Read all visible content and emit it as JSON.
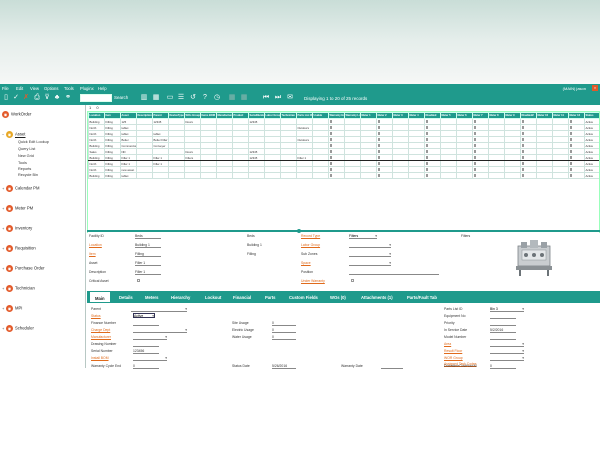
{
  "menu": [
    "File",
    "Edit",
    "View",
    "Options",
    "Tools",
    "Pluginx",
    "Help"
  ],
  "user": "(MAIN)  jason",
  "close_icon": "×",
  "toolbar": {
    "search_label": "Search",
    "records_label": "Displaying 1 to 20 of 25 records"
  },
  "sidebar": {
    "items": [
      {
        "label": "WorkOrder",
        "color": "#e35b2b"
      },
      {
        "label": "Asset",
        "color": "#e8a826"
      },
      {
        "label": "Calendar PM",
        "color": "#e35b2b"
      },
      {
        "label": "Meter PM",
        "color": "#e35b2b"
      },
      {
        "label": "Inventory",
        "color": "#e35b2b"
      },
      {
        "label": "Requisition",
        "color": "#e35b2b"
      },
      {
        "label": "Purchase Order",
        "color": "#e35b2b"
      },
      {
        "label": "Technician",
        "color": "#e35b2b"
      },
      {
        "label": "MPI",
        "color": "#e35b2b"
      },
      {
        "label": "Scheduler",
        "color": "#e35b2b"
      }
    ],
    "asset_children": [
      "Quick Edit Lookup",
      "Query List",
      "New Grid",
      "Tools",
      "Reports",
      "Recycle Bin"
    ]
  },
  "grid_tabs": [
    "1",
    "0"
  ],
  "grid": {
    "headers": [
      "Location",
      "Item",
      "Asset",
      "Description",
      "Parent",
      "DeviceType",
      "WOs Group",
      "Items BOM",
      "Manufacturer",
      "Product",
      "SerialNumber",
      "Labor Group",
      "Technician",
      "Parts List ID",
      "Usable",
      "Warranty End",
      "Warranty Location",
      "Meter 1",
      "Meter 2",
      "Meter 3",
      "Meter 4",
      "Disabled",
      "Meter 5",
      "Meter 6",
      "Meter 7",
      "Meter 8",
      "Meter 9",
      "Disabled2",
      "Meter 10",
      "Meter 11",
      "Meter 12",
      "Status"
    ],
    "rows": [
      [
        "Building",
        "Filling",
        "125",
        "",
        "12345",
        "",
        "Doors",
        "",
        "",
        "",
        "12345",
        "",
        "",
        "",
        "",
        "",
        "",
        "",
        "",
        "",
        "",
        "",
        "",
        "",
        "",
        "",
        "",
        "",
        "",
        "",
        "",
        "Active"
      ],
      [
        "North",
        "Filling",
        "tablet",
        "",
        "",
        "",
        "",
        "",
        "",
        "",
        "",
        "",
        "",
        "Outdoors",
        "",
        "",
        "",
        "",
        "",
        "",
        "",
        "",
        "",
        "",
        "",
        "",
        "",
        "",
        "",
        "",
        "",
        "Active"
      ],
      [
        "North",
        "Filling",
        "tablet",
        "",
        "tablet",
        "",
        "",
        "",
        "",
        "",
        "",
        "",
        "",
        "",
        "",
        "",
        "",
        "",
        "",
        "",
        "",
        "",
        "",
        "",
        "",
        "",
        "",
        "",
        "",
        "",
        "",
        "Active"
      ],
      [
        "North",
        "Filling",
        "Boiler",
        "",
        "Boiler Filler",
        "",
        "",
        "",
        "",
        "",
        "",
        "",
        "",
        "Outdoors",
        "",
        "",
        "",
        "",
        "",
        "",
        "",
        "",
        "",
        "",
        "",
        "",
        "",
        "",
        "",
        "",
        "",
        "Active"
      ],
      [
        "Building",
        "Filling",
        "Commercial Conveyor",
        "",
        "Conveyer",
        "",
        "",
        "",
        "",
        "",
        "",
        "",
        "",
        "",
        "",
        "",
        "",
        "",
        "",
        "",
        "",
        "",
        "",
        "",
        "",
        "",
        "",
        "",
        "",
        "",
        "",
        "Active"
      ],
      [
        "Sales",
        "Filling",
        "ND",
        "",
        "",
        "",
        "Doors",
        "",
        "",
        "",
        "12345",
        "",
        "",
        "",
        "",
        "",
        "",
        "",
        "",
        "",
        "",
        "",
        "",
        "",
        "",
        "",
        "",
        "",
        "",
        "",
        "",
        "Active"
      ],
      [
        "Building",
        "Filling",
        "Filler 1",
        "",
        "Filler 1",
        "",
        "Filters",
        "",
        "",
        "",
        "12345",
        "",
        "",
        "Filter 1",
        "",
        "",
        "",
        "",
        "",
        "",
        "",
        "",
        "",
        "",
        "",
        "",
        "",
        "",
        "",
        "",
        "",
        "Active"
      ],
      [
        "North",
        "Filling",
        "Filler 1",
        "",
        "Filler 1",
        "",
        "",
        "",
        "",
        "",
        "",
        "",
        "",
        "",
        "",
        "",
        "",
        "",
        "",
        "",
        "",
        "",
        "",
        "",
        "",
        "",
        "",
        "",
        "",
        "",
        "",
        "Active"
      ],
      [
        "North",
        "Filling",
        "new asset",
        "",
        "",
        "",
        "",
        "",
        "",
        "",
        "",
        "",
        "",
        "",
        "",
        "",
        "",
        "",
        "",
        "",
        "",
        "",
        "",
        "",
        "",
        "",
        "",
        "",
        "",
        "",
        "",
        "Active"
      ],
      [
        "Building",
        "Filling",
        "tablet",
        "",
        "",
        "",
        "",
        "",
        "",
        "",
        "",
        "",
        "",
        "",
        "",
        "",
        "",
        "",
        "",
        "",
        "",
        "",
        "",
        "",
        "",
        "",
        "",
        "",
        "",
        "",
        "",
        "Active"
      ]
    ]
  },
  "detail": {
    "facility_label": "Facility ID",
    "facility_value": "Beds",
    "location_label": "Location",
    "location_value": "Building 1",
    "item_label": "Item",
    "item_value": "Filling",
    "asset_label": "Asset",
    "asset_value": "Filler 1",
    "description_label": "Description",
    "description_value": "Filler 1",
    "critical_label": "Critical Asset",
    "beds_label": "Beds",
    "building_label": "Building 1",
    "filling_label": "Filling",
    "record_type_label": "Record Type",
    "record_type_value": "Filters",
    "labor_group_label": "Labor Group",
    "sub_zones_label": "Sub Zones",
    "space_label": "Space",
    "position_label": "Position",
    "under_warranty_label": "Under Warranty",
    "filters_label": "Filters"
  },
  "tabs": [
    "Main",
    "Details",
    "Meters",
    "Hierarchy",
    "Lockout",
    "Financial",
    "Parts",
    "Custom Fields",
    "WOs (0)",
    "Attachments (1)",
    "Parts/Fault Tab"
  ],
  "main_tab": {
    "parent_label": "Parent",
    "status_label": "Status",
    "status_value": "Active",
    "finance_label": "Finance Number",
    "charge_dept_label": "Charge Dept",
    "manufacturer_label": "Manufacturer",
    "drawing_label": "Drawing Number",
    "serial_label": "Serial Number",
    "serial_value": "123456",
    "install_bom_label": "Install BOM",
    "site_usage_label": "Site Usage",
    "site_usage_value": "0",
    "electric_label": "Electric Usage",
    "electric_value": "0",
    "water_label": "Water Usage",
    "water_value": "0",
    "parts_list_label": "Parts List ID",
    "parts_list_value": "Bin 3",
    "equipment_label": "Equipment No",
    "priority_label": "Priority",
    "in_service_label": "In Service Date",
    "in_service_value": "5/2/2016",
    "model_label": "Model Number",
    "area_label": "Area",
    "result_floor_label": "Result Floor",
    "wor_group_label": "WOR Group",
    "assigned_task_label": "Assigned Task Codes",
    "warranty_cycle_label": "Warranty Cycle End",
    "warranty_cycle_value": "0",
    "status_date_label": "Status Date",
    "status_date_value": "5/26/2016",
    "warranty_date_label": "Warranty Date",
    "downtime_label": "DowntimeCostHourAt",
    "downtime_value": "0"
  }
}
